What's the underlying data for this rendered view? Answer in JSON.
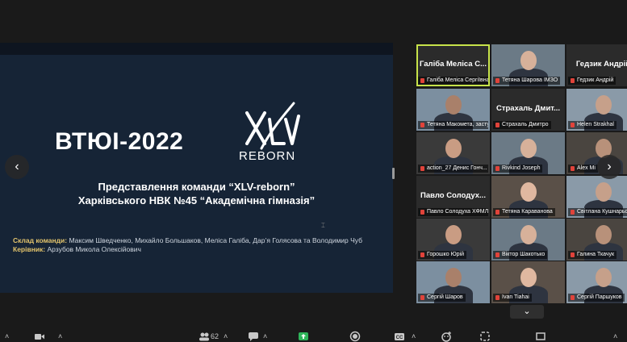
{
  "slide": {
    "title": "ВТЮІ-2022",
    "logo_text": "REBORN",
    "heading_line1": "Представлення команди “XLV-reborn”",
    "heading_line2": "Харківського НВК №45 “Академічна гімназія”",
    "team_label": "Склад команди:",
    "team_value": " Максим Шведченко, Михайло Большаков, Меліса Галіба, Дар’я Голясова та Володимир Чуб",
    "lead_label": "Керівник:",
    "lead_value": " Арзубов Микола Олексійович"
  },
  "participants": [
    {
      "display": "Галіба Меліса С...",
      "label": "Галіба Меліса Сергіївна Х..."
    },
    {
      "display": "",
      "label": "Тетяна Шарова ІМЗО"
    },
    {
      "display": "Гедзик Андрій",
      "label": "Гедзик Андрій"
    },
    {
      "display": "",
      "label": "Тетяна Макомета, засту..."
    },
    {
      "display": "Страхаль Дмит...",
      "label": "Страхаль Дмитро"
    },
    {
      "display": "",
      "label": "Helen Strakhal"
    },
    {
      "display": "",
      "label": "action_27 Денис Гонч..."
    },
    {
      "display": "",
      "label": "Rivkind Joseph"
    },
    {
      "display": "",
      "label": "Alex Mi"
    },
    {
      "display": "Павло Солодух...",
      "label": "Павло Солодуха ХФМЛ..."
    },
    {
      "display": "",
      "label": "Тетяна Караванова"
    },
    {
      "display": "",
      "label": "Світлана Кушнарьова"
    },
    {
      "display": "",
      "label": "Горошко Юрій"
    },
    {
      "display": "",
      "label": "Віктор Шакотько"
    },
    {
      "display": "",
      "label": "Галина Ткачук"
    },
    {
      "display": "",
      "label": "Сергій Шаров"
    },
    {
      "display": "",
      "label": "Ivan Tiahai"
    },
    {
      "display": "",
      "label": "Сергій Паршуков"
    }
  ],
  "toolbar": {
    "participants_count": "62"
  },
  "icons": {
    "nav_left": "chevron-left-icon",
    "nav_right": "chevron-right-icon",
    "gallery_down": "chevron-down-icon",
    "muted": "mic-muted-icon"
  },
  "colors": {
    "active_speaker": "#c7e34a",
    "muted_icon": "#e0433a",
    "slide_bg": "#162436",
    "accent_text": "#e3c46c"
  }
}
